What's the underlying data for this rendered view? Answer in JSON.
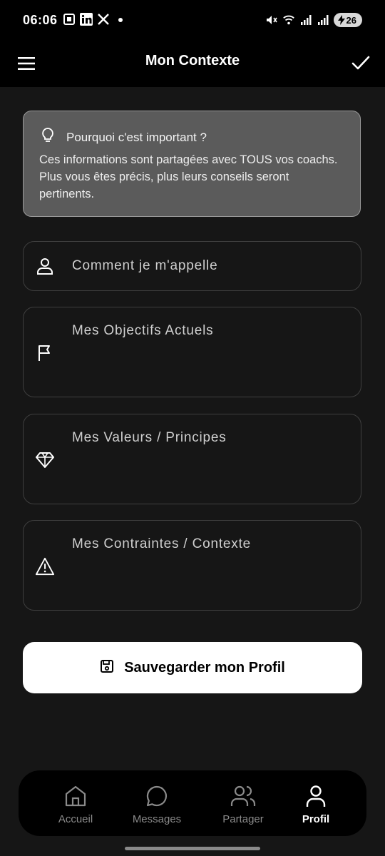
{
  "status": {
    "time": "06:06",
    "battery": "26",
    "left_icons": [
      "screenshot-icon",
      "linkedin-icon",
      "x-icon",
      "dot-icon"
    ],
    "right_icons": [
      "mute-icon",
      "wifi-icon",
      "signal-icon",
      "signal-icon",
      "battery-icon"
    ]
  },
  "appbar": {
    "title": "Mon Contexte"
  },
  "info": {
    "title": "Pourquoi c'est important ?",
    "body": "Ces informations sont partagées avec TOUS vos coachs. Plus vous êtes précis, plus leurs conseils seront pertinents."
  },
  "fields": [
    {
      "placeholder": "Comment je m'appelle",
      "icon": "user-icon"
    },
    {
      "placeholder": "Mes Objectifs Actuels",
      "icon": "flag-icon"
    },
    {
      "placeholder": "Mes Valeurs / Principes",
      "icon": "diamond-icon"
    },
    {
      "placeholder": "Mes Contraintes / Contexte",
      "icon": "warning-icon"
    }
  ],
  "save_button": {
    "label": "Sauvegarder mon Profil"
  },
  "nav": [
    {
      "label": "Accueil",
      "icon": "home-icon",
      "active": false
    },
    {
      "label": "Messages",
      "icon": "message-icon",
      "active": false
    },
    {
      "label": "Partager",
      "icon": "users-icon",
      "active": false
    },
    {
      "label": "Profil",
      "icon": "profile-icon",
      "active": true
    }
  ],
  "colors": {
    "background": "#161616",
    "card": "#5b5b5b",
    "accent": "#ffffff"
  }
}
